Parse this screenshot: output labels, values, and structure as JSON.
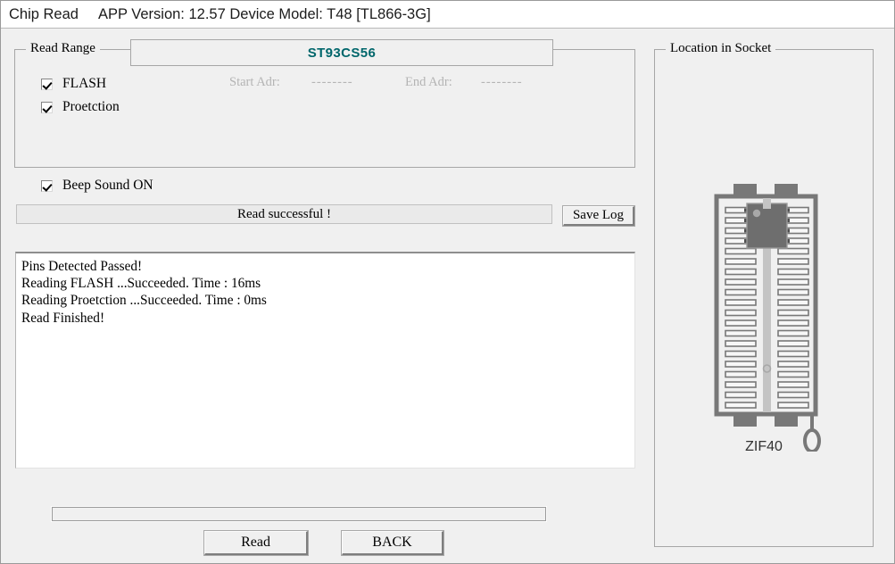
{
  "titlebar": {
    "app_title": "Chip Read",
    "info": "APP Version: 12.57 Device Model: T48 [TL866-3G]"
  },
  "read_range": {
    "group_label": "Read Range",
    "chip_name": "ST93CS56",
    "chip_name_color": "#00666b",
    "checkboxes": [
      {
        "label": "FLASH",
        "checked": true
      },
      {
        "label": "Proetction",
        "checked": true
      }
    ],
    "start_adr_label": "Start Adr:",
    "start_adr_value": "--------",
    "end_adr_label": "End Adr:",
    "end_adr_value": "--------",
    "disabled_color": "#b4b4b4"
  },
  "beep": {
    "label": "Beep Sound ON",
    "checked": true
  },
  "status": {
    "message": "Read successful !"
  },
  "toolbar": {
    "save_log_label": "Save Log"
  },
  "log": {
    "lines": [
      "Pins Detected Passed!",
      "Reading FLASH ...Succeeded. Time : 16ms",
      "Reading Proetction ...Succeeded. Time : 0ms",
      "Read Finished!"
    ]
  },
  "progress": {
    "percent": 0
  },
  "buttons": {
    "read_label": "Read",
    "back_label": "BACK"
  },
  "socket": {
    "group_label": "Location in Socket",
    "zif_label": "ZIF40",
    "pin_rows": 20,
    "chip_pins_per_side": 4,
    "body_color": "#f0f0f0",
    "frame_color": "#787878",
    "chip_color": "#6e6e6e"
  }
}
